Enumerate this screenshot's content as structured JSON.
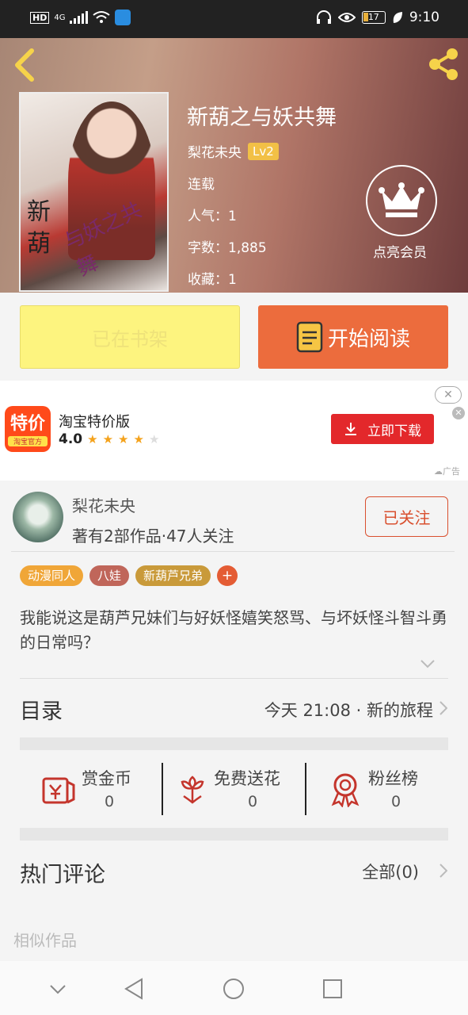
{
  "status_bar": {
    "network": "HD",
    "net_type": "4G",
    "battery": "17",
    "time": "9:10"
  },
  "book": {
    "title": "新葫之与妖共舞",
    "author": "梨花未央",
    "level": "Lv2",
    "status": "连载",
    "popularity": "人气：1",
    "word_count": "字数：1,885",
    "favorites": "收藏：1",
    "cover_title": "新葫",
    "cover_subtitle": "与妖之共舞"
  },
  "vip": {
    "label": "点亮会员"
  },
  "actions": {
    "shelf_label": "已在书架",
    "read_label": "开始阅读"
  },
  "ad": {
    "logo_big": "特价",
    "logo_small": "淘宝官方",
    "name": "淘宝特价版",
    "rating": "4.0",
    "stars_filled": 4,
    "stars_total": 5,
    "download_label": "立即下载",
    "close_label": "✕",
    "ad_tag": "广告"
  },
  "author": {
    "name": "梨花未央",
    "stats": "著有2部作品·47人关注",
    "follow_label": "已关注"
  },
  "tags": [
    {
      "label": "动漫同人",
      "color": "#f0a638"
    },
    {
      "label": "八娃",
      "color": "#c0665a"
    },
    {
      "label": "新葫芦兄弟",
      "color": "#c99a3a"
    }
  ],
  "tag_plus": "+",
  "description": "我能说这是葫芦兄妹们与好妖怪嬉笑怒骂、与坏妖怪斗智斗勇的日常吗？",
  "toc": {
    "title": "目录",
    "latest": "今天 21:08 · 新的旅程"
  },
  "rewards": [
    {
      "label": "赏金币",
      "count": "0",
      "icon": "gold-coin-envelope-icon"
    },
    {
      "label": "免费送花",
      "count": "0",
      "icon": "flower-icon"
    },
    {
      "label": "粉丝榜",
      "count": "0",
      "icon": "award-ribbon-icon"
    }
  ],
  "comments": {
    "title": "热门评论",
    "all_label": "全部(0)"
  },
  "similar": {
    "title": "相似作品"
  },
  "colors": {
    "accent": "#ec6c3d",
    "shelf": "#fdf47f",
    "follow": "#d9502f",
    "download": "#e3282b"
  }
}
